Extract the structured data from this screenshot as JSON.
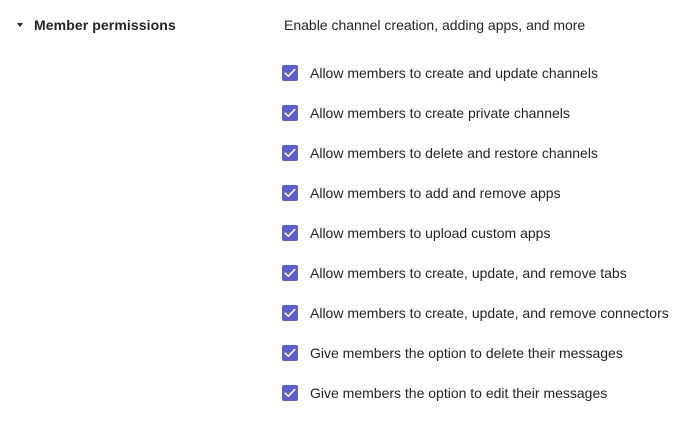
{
  "section": {
    "title": "Member permissions",
    "description": "Enable channel creation, adding apps, and more",
    "expanded": true,
    "caret_icon": "caret-down-icon"
  },
  "colors": {
    "checkbox_checked": "#5b5fc7",
    "text": "#242424",
    "background": "#ffffff"
  },
  "options": [
    {
      "label": "Allow members to create and update channels",
      "checked": true
    },
    {
      "label": "Allow members to create private channels",
      "checked": true
    },
    {
      "label": "Allow members to delete and restore channels",
      "checked": true
    },
    {
      "label": "Allow members to add and remove apps",
      "checked": true
    },
    {
      "label": "Allow members to upload custom apps",
      "checked": true
    },
    {
      "label": "Allow members to create, update, and remove tabs",
      "checked": true
    },
    {
      "label": "Allow members to create, update, and remove connectors",
      "checked": true
    },
    {
      "label": "Give members the option to delete their messages",
      "checked": true
    },
    {
      "label": "Give members the option to edit their messages",
      "checked": true
    }
  ]
}
